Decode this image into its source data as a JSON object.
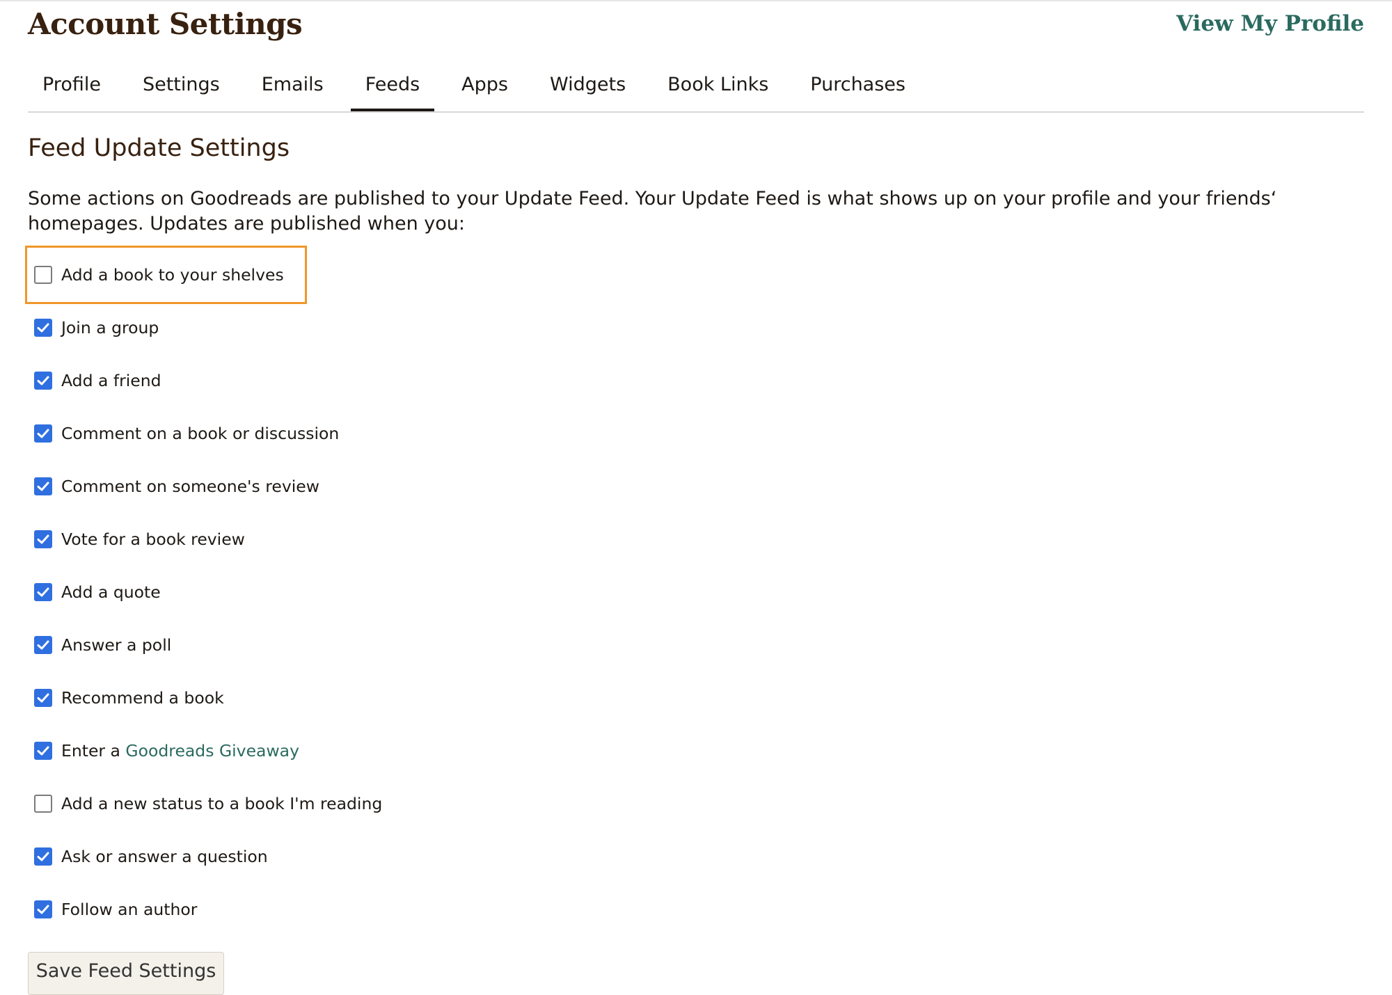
{
  "header": {
    "title": "Account Settings",
    "view_profile_label": "View My Profile"
  },
  "tabs": [
    {
      "label": "Profile",
      "active": false
    },
    {
      "label": "Settings",
      "active": false
    },
    {
      "label": "Emails",
      "active": false
    },
    {
      "label": "Feeds",
      "active": true
    },
    {
      "label": "Apps",
      "active": false
    },
    {
      "label": "Widgets",
      "active": false
    },
    {
      "label": "Book Links",
      "active": false
    },
    {
      "label": "Purchases",
      "active": false
    }
  ],
  "section": {
    "title": "Feed Update Settings",
    "intro": "Some actions on Goodreads are published to your Update Feed. Your Update Feed is what shows up on your profile and your friends‘ homepages. Updates are published when you:"
  },
  "options": [
    {
      "label": "Add a book to your shelves",
      "checked": false,
      "highlighted": true
    },
    {
      "label": "Join a group",
      "checked": true
    },
    {
      "label": "Add a friend",
      "checked": true
    },
    {
      "label": "Comment on a book or discussion",
      "checked": true
    },
    {
      "label": "Comment on someone's review",
      "checked": true
    },
    {
      "label": "Vote for a book review",
      "checked": true
    },
    {
      "label": "Add a quote",
      "checked": true
    },
    {
      "label": "Answer a poll",
      "checked": true
    },
    {
      "label": "Recommend a book",
      "checked": true
    },
    {
      "label": "Enter a ",
      "link": "Goodreads Giveaway",
      "checked": true
    },
    {
      "label": "Add a new status to a book I'm reading",
      "checked": false
    },
    {
      "label": "Ask or answer a question",
      "checked": true
    },
    {
      "label": "Follow an author",
      "checked": true
    }
  ],
  "save_button_label": "Save Feed Settings",
  "colors": {
    "title": "#382110",
    "link": "#2a6a5f",
    "checkbox_checked": "#2f6fe0",
    "highlight_border": "#f0972a",
    "button_bg": "#f4f1ea"
  }
}
